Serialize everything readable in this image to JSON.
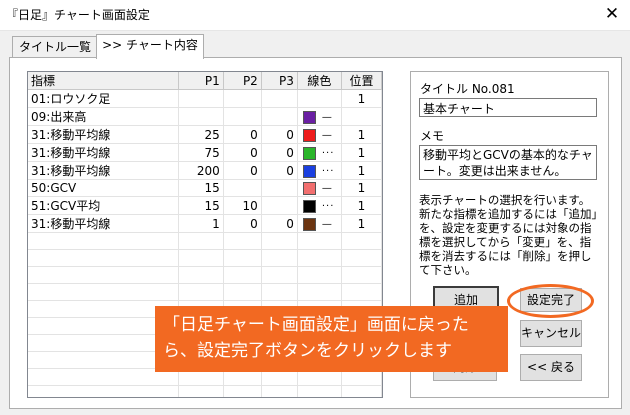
{
  "window": {
    "title": "『日足』チャート画面設定",
    "close_glyph": "✕"
  },
  "tabs": [
    {
      "label": "タイトル一覧",
      "active": false
    },
    {
      "label": ">> チャート内容",
      "active": true
    }
  ],
  "grid": {
    "columns": [
      "指標",
      "P1",
      "P2",
      "P3",
      "線色",
      "位置"
    ],
    "rows": [
      {
        "name": "01:ロウソク足",
        "p1": "",
        "p2": "",
        "p3": "",
        "color": "",
        "line": "",
        "pos": "1"
      },
      {
        "name": "09:出来高",
        "p1": "",
        "p2": "",
        "p3": "",
        "color": "#6a1fa3",
        "line": "—",
        "pos": ""
      },
      {
        "name": "31:移動平均線",
        "p1": "25",
        "p2": "0",
        "p3": "0",
        "color": "#ee1c1c",
        "line": "—",
        "pos": "1"
      },
      {
        "name": "31:移動平均線",
        "p1": "75",
        "p2": "0",
        "p3": "0",
        "color": "#2ab52a",
        "line": "···",
        "pos": "1"
      },
      {
        "name": "31:移動平均線",
        "p1": "200",
        "p2": "0",
        "p3": "0",
        "color": "#1a3fe0",
        "line": "···",
        "pos": "1"
      },
      {
        "name": "50:GCV",
        "p1": "15",
        "p2": "",
        "p3": "",
        "color": "#f26f6f",
        "line": "—",
        "pos": "1"
      },
      {
        "name": "51:GCV平均",
        "p1": "15",
        "p2": "10",
        "p3": "",
        "color": "#000000",
        "line": "···",
        "pos": "1"
      },
      {
        "name": "31:移動平均線",
        "p1": "1",
        "p2": "0",
        "p3": "0",
        "color": "#6b3410",
        "line": "—",
        "pos": "1"
      }
    ]
  },
  "side": {
    "title_label": "タイトル No.081",
    "title_value": "基本チャート",
    "memo_label": "メモ",
    "memo_value": "移動平均とGCVの基本的なチャート。変更は出来ません。",
    "help_text": "表示チャートの選択を行います。新たな指標を追加するには「追加」を、設定を変更するには対象の指標を選択してから「変更」を、指標を消去するには「削除」を押して下さい。"
  },
  "buttons": {
    "add": "追加",
    "done": "設定完了",
    "cancel": "キャンセル",
    "delete": "削除",
    "back": "<< 戻る"
  },
  "annotation": {
    "line1": "「日足チャート画面設定」画面に戻った",
    "line2": "ら、設定完了ボタンをクリックします",
    "accent": "#f26922"
  }
}
